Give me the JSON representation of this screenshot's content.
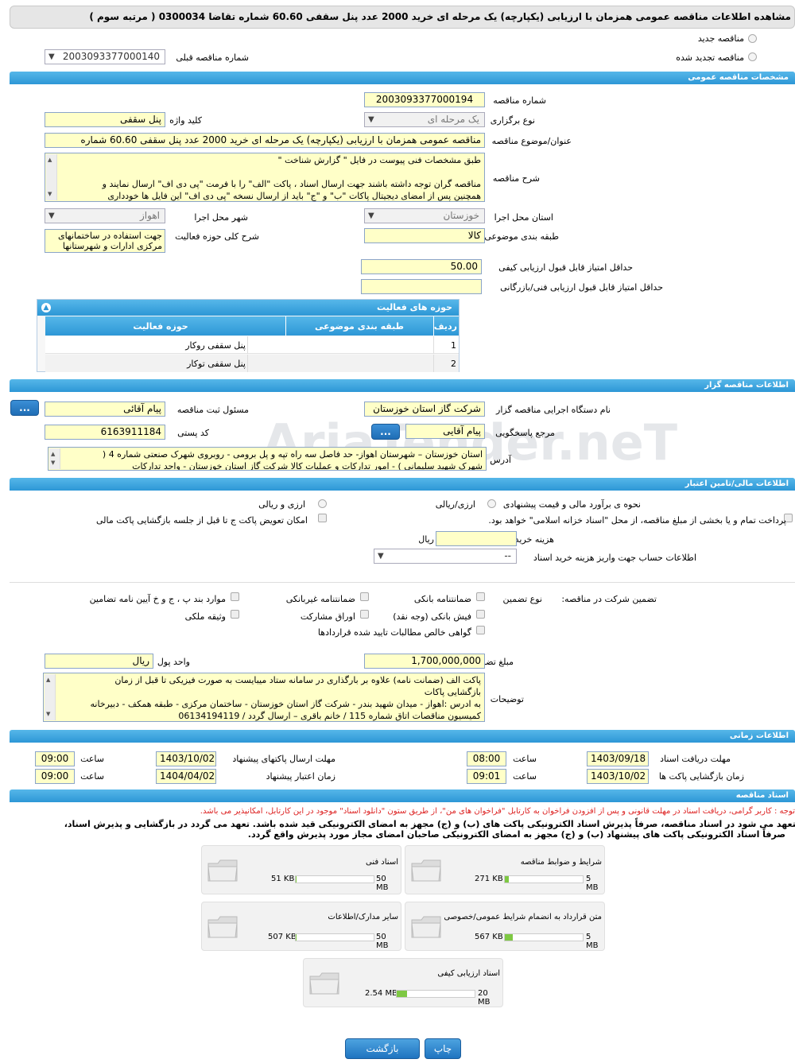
{
  "page_title": "مشاهده اطلاعات مناقصه عمومی همزمان با ارزیابی (یکپارچه) یک مرحله ای خرید 2000 عدد پنل سقفی 60.60 شماره تقاضا 0300034 ( مرتبه سوم )",
  "top": {
    "new_label": "مناقصه جدید",
    "renewed_label": "مناقصه تجدید شده",
    "prev_label": "شماره مناقصه قبلی",
    "prev_value": "2003093377000140"
  },
  "watermark": "AriaTender.neT",
  "sections": {
    "general": "مشخصات مناقصه عمومی",
    "organizer": "اطلاعات مناقصه گزار",
    "finance": "اطلاعات مالی/تامین اعتبار",
    "timing": "اطلاعات زمانی",
    "docs": "اسناد مناقصه"
  },
  "general": {
    "number_label": "شماره مناقصه",
    "number_value": "2003093377000194",
    "type_label": "نوع برگزاری",
    "type_value": "یک مرحله ای",
    "keyword_label": "کلید واژه",
    "keyword_value": "پنل سقفی",
    "subject_label": "عنوان/موضوع مناقصه",
    "subject_value": "مناقصه عمومی همزمان با ارزیابی (یکپارچه) یک مرحله ای خرید 2000 عدد پنل سقفی 60.60 شماره",
    "desc_label": "شرح مناقصه",
    "desc_lines": [
      "طبق مشخصات فنی پیوست در فایل  \" گزارش شناخت \"",
      "",
      "مناقصه گران توجه داشته باشند جهت ارسال اسناد ، پاکت \"الف\" را با فرمت  \"پی دی اف\"  ارسال نمایند و",
      "همچنین پس از امضای دیجیتال پاکات  \"ب\" و \"ج\" باید از ارسال نسخه \"پی دی اف\"  این فایل ها خودداری"
    ],
    "province_label": "استان محل اجرا",
    "province_value": "خوزستان",
    "city_label": "شهر محل اجرا",
    "city_value": "اهواز",
    "category_label": "طبقه بندی موضوعی",
    "category_value": "کالا",
    "scope_label": "شرح کلی حوزه فعالیت",
    "scope_value": "جهت استفاده در ساختمانهای مرکزی ادارات و شهرستانها",
    "min_quality_label": "حداقل امتیاز قابل قبول ارزیابی کیفی",
    "min_quality_value": "50.00",
    "min_tech_label": "حداقل امتیاز قابل قبول ارزیابی فنی/بازرگانی",
    "min_tech_value": ""
  },
  "activity": {
    "title": "حوزه های فعالیت",
    "headers": [
      "ردیف",
      "طبقه بندی موضوعی",
      "حوزه فعالیت"
    ],
    "rows": [
      [
        "1",
        "",
        "پنل سقفی روکار"
      ],
      [
        "2",
        "",
        "پنل سقفی توکار"
      ]
    ]
  },
  "organizer": {
    "org_label": "نام دستگاه اجرایی مناقصه گزار",
    "org_value": "شرکت گاز استان خوزستان",
    "reg_label": "مسئول ثبت مناقصه",
    "reg_value": "پیام  آقائی",
    "ref_label": "مرجع پاسخگویی",
    "ref_value": "پیام آقایی",
    "postal_label": "کد پستی",
    "postal_value": "6163911184",
    "addr_label": "آدرس",
    "addr_lines": [
      "استان خوزستان – شهرستان اهواز- حد فاصل سه راه تپه  و پل برومی - روبروی شهرک صنعتی شماره 4 (",
      "شهرک شهید سلیمانی  ) - امور تدارکات و عملیات کالا شرکت گاز استان خوزستان - واحد تدارکات"
    ],
    "more_btn": "..."
  },
  "finance": {
    "estimate_label": "نحوه ی برآورد مالی و قیمت پیشنهادی",
    "opt1": "ارزی/ریالی",
    "opt2": "ارزی و ریالی",
    "partial_label": "پرداخت تمام و یا بخشی از مبلغ مناقصه، از محل \"اسناد خزانه اسلامی\" خواهد بود.",
    "swap_label": "امکان تعویض پاکت ج تا قبل از جلسه بازگشایی پاکت مالی",
    "doc_cost_label": "هزینه خرید اسناد",
    "doc_cost_unit": "ریال",
    "doc_cost_value": "",
    "account_label": "اطلاعات حساب جهت واریز هزینه خرید اسناد",
    "account_value": "--"
  },
  "guarantee": {
    "participate_label": "تضمین شرکت در مناقصه:",
    "type_label": "نوع تضمین",
    "items": [
      "ضمانتنامه بانکی",
      "ضمانتنامه غیربانکی",
      "موارد بند پ ، ج و خ آیین نامه تضامین",
      "فیش بانکی (وجه نقد)",
      "اوراق مشارکت",
      "وثیقه ملکی",
      "گواهی خالص مطالبات تایید شده قراردادها"
    ],
    "amount_label": "مبلغ تضمین",
    "amount_value": "1,700,000,000",
    "currency_label": "واحد پول",
    "currency_value": "ریال",
    "notes_label": "توضیحات",
    "notes_lines": [
      "پاکت الف (ضمانت نامه) علاوه بر بارگذاری در سامانه ستاد میبایست به صورت فیزیکی تا قبل از زمان",
      "بازگشایی پاکات",
      "به ادرس :اهواز - میدان شهید بندر - شرکت گاز استان خوزستان - ساختمان مرکزی - طبقه همکف - دبیرخانه",
      "کمیسیون مناقصات  اتاق شماره 115 / خانم باقری – ارسال گردد / 06134194119"
    ]
  },
  "timing": {
    "doc_deadline_label": "مهلت دریافت اسناد",
    "doc_deadline_date": "1403/09/18",
    "doc_deadline_time": "08:00",
    "send_label": "مهلت ارسال پاکتهای پیشنهاد",
    "send_date": "1403/10/02",
    "send_time": "09:00",
    "open_label": "زمان بازگشایی پاکت ها",
    "open_date": "1403/10/02",
    "open_time": "09:01",
    "valid_label": "زمان اعتبار پیشنهاد",
    "valid_date": "1404/04/02",
    "valid_time": "09:00",
    "time_label": "ساعت"
  },
  "docs": {
    "note_red": "توجه : کاربر گرامی، دریافت اسناد در مهلت قانونی و پس از افزودن فراخوان به کارتابل \"فراخوان های من\"، از طریق ستون \"دانلود اسناد\" موجود در این کارتابل، امکانپذیر می باشد.",
    "note_bold1": "متعهد می شود در اسناد مناقصه، صرفاً پذیرش اسناد الکترونیکی پاکت های (ب) و (ج) مجهز به امضای الکترونیکی قید شده باشد. تعهد می گردد در بازگشایی و پذیرش اسناد،",
    "note_bold2": "صرفاً اسناد الکترونیکی پاکت های پیشنهاد (ب) و (ج) مجهز به امضای الکترونیکی صاحبان امضای مجاز مورد پذیرش واقع گردد.",
    "files": [
      {
        "name": "شرایط و ضوابط مناقصه",
        "size": "271 KB",
        "max": "5 MB",
        "fill": 0.05
      },
      {
        "name": "اسناد فنی",
        "size": "51 KB",
        "max": "50 MB",
        "fill": 0.01
      },
      {
        "name": "متن قرارداد به انضمام شرایط عمومی/خصوصی",
        "size": "567 KB",
        "max": "5 MB",
        "fill": 0.1
      },
      {
        "name": "سایر مدارک/اطلاعات",
        "size": "507 KB",
        "max": "50 MB",
        "fill": 0.01
      },
      {
        "name": "اسناد ارزیابی کیفی",
        "size": "2.54 MB",
        "max": "20 MB",
        "fill": 0.13
      }
    ]
  },
  "buttons": {
    "print": "چاپ",
    "back": "بازگشت"
  }
}
